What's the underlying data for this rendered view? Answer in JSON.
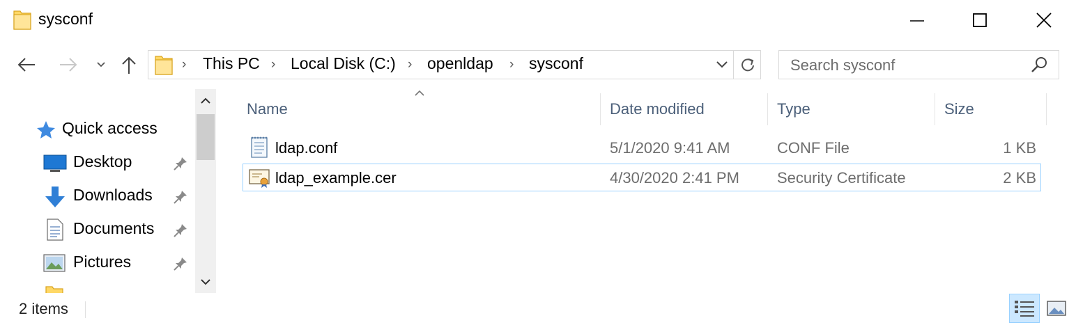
{
  "window": {
    "title": "sysconf"
  },
  "address": {
    "crumbs": [
      "This PC",
      "Local Disk (C:)",
      "openldap",
      "sysconf"
    ]
  },
  "search": {
    "placeholder": "Search sysconf",
    "value": ""
  },
  "nav": {
    "items": [
      {
        "label": "Quick access",
        "icon": "star-icon"
      },
      {
        "label": "Desktop",
        "icon": "desktop-icon",
        "pinned": true
      },
      {
        "label": "Downloads",
        "icon": "download-arrow-icon",
        "pinned": true
      },
      {
        "label": "Documents",
        "icon": "documents-icon",
        "pinned": true
      },
      {
        "label": "Pictures",
        "icon": "pictures-icon",
        "pinned": true
      }
    ]
  },
  "columns": {
    "name": "Name",
    "date": "Date modified",
    "type": "Type",
    "size": "Size"
  },
  "files": [
    {
      "name": "ldap.conf",
      "date": "5/1/2020 9:41 AM",
      "type": "CONF File",
      "size": "1 KB",
      "icon": "text-file-icon"
    },
    {
      "name": "ldap_example.cer",
      "date": "4/30/2020 2:41 PM",
      "type": "Security Certificate",
      "size": "2 KB",
      "icon": "certificate-icon"
    }
  ],
  "status": {
    "count": "2 items"
  },
  "colors": {
    "selection_border": "#99d1ff",
    "selection_fill": "#cce8ff",
    "header_text": "#4c607a",
    "folder": "#ffd866"
  }
}
